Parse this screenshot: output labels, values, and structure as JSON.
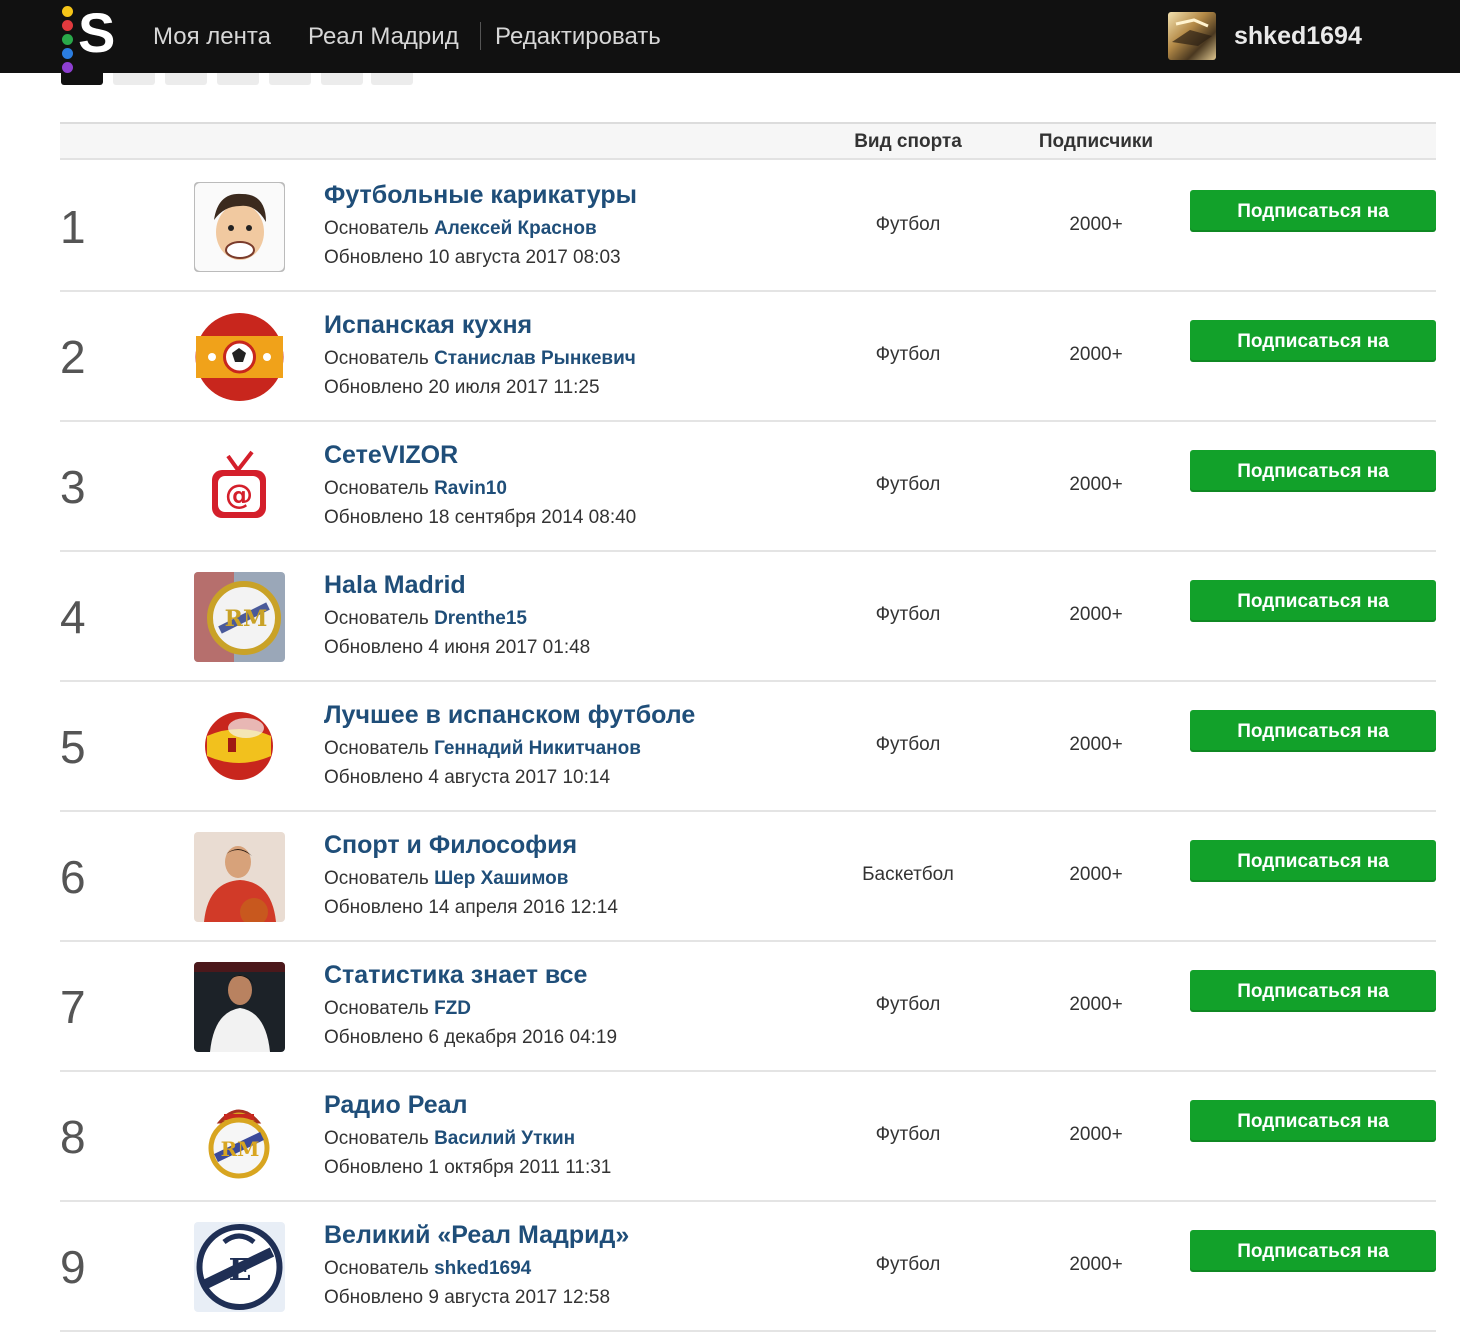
{
  "header": {
    "nav": [
      "Моя лента",
      "Реал Мадрид",
      "Редактировать"
    ],
    "user_name": "shked1694"
  },
  "table": {
    "col_sport": "Вид спорта",
    "col_subscribers": "Подписчики"
  },
  "rows": [
    {
      "rank": "1",
      "title": "Футбольные карикатуры",
      "founder_label": "Основатель",
      "founder": "Алексей Краснов",
      "updated": "Обновлено 10 августа 2017 08:03",
      "sport": "Футбол",
      "subscribers": "2000+",
      "button": "Подписаться на",
      "thumb": "caricature"
    },
    {
      "rank": "2",
      "title": "Испанская кухня",
      "founder_label": "Основатель",
      "founder": "Станислав Рынкевич",
      "updated": "Обновлено 20 июля 2017 11:25",
      "sport": "Футбол",
      "subscribers": "2000+",
      "button": "Подписаться на",
      "thumb": "spain-ball"
    },
    {
      "rank": "3",
      "title": "СетеVIZOR",
      "founder_label": "Основатель",
      "founder": "Ravin10",
      "updated": "Обновлено 18 сентября 2014 08:40",
      "sport": "Футбол",
      "subscribers": "2000+",
      "button": "Подписаться на",
      "thumb": "tv-at"
    },
    {
      "rank": "4",
      "title": "Hala Madrid",
      "founder_label": "Основатель",
      "founder": "Drenthe15",
      "updated": "Обновлено 4 июня 2017 01:48",
      "sport": "Футбол",
      "subscribers": "2000+",
      "button": "Подписаться на",
      "thumb": "rm-crest-photo"
    },
    {
      "rank": "5",
      "title": "Лучшее в испанском футболе",
      "founder_label": "Основатель",
      "founder": "Геннадий Никитчанов",
      "updated": "Обновлено 4 августа 2017 10:14",
      "sport": "Футбол",
      "subscribers": "2000+",
      "button": "Подписаться на",
      "thumb": "spain-flag-ball"
    },
    {
      "rank": "6",
      "title": "Спорт и Философия",
      "founder_label": "Основатель",
      "founder": "Шер Хашимов",
      "updated": "Обновлено 14 апреля 2016 12:14",
      "sport": "Баскетбол",
      "subscribers": "2000+",
      "button": "Подписаться на",
      "thumb": "basketball-player"
    },
    {
      "rank": "7",
      "title": "Статистика знает все",
      "founder_label": "Основатель",
      "founder": "FZD",
      "updated": "Обновлено 6 декабря 2016 04:19",
      "sport": "Футбол",
      "subscribers": "2000+",
      "button": "Подписаться на",
      "thumb": "football-player"
    },
    {
      "rank": "8",
      "title": "Радио Реал",
      "founder_label": "Основатель",
      "founder": "Василий Уткин",
      "updated": "Обновлено 1 октября 2011 11:31",
      "sport": "Футбол",
      "subscribers": "2000+",
      "button": "Подписаться на",
      "thumb": "rm-crest"
    },
    {
      "rank": "9",
      "title": "Великий «Реал Мадрид»",
      "founder_label": "Основатель",
      "founder": "shked1694",
      "updated": "Обновлено 9 августа 2017 12:58",
      "sport": "Футбол",
      "subscribers": "2000+",
      "button": "Подписаться на",
      "thumb": "rm-crest-bw"
    }
  ],
  "colors": {
    "topbar": "#111111",
    "link": "#1f4e79",
    "button": "#12a12a"
  }
}
